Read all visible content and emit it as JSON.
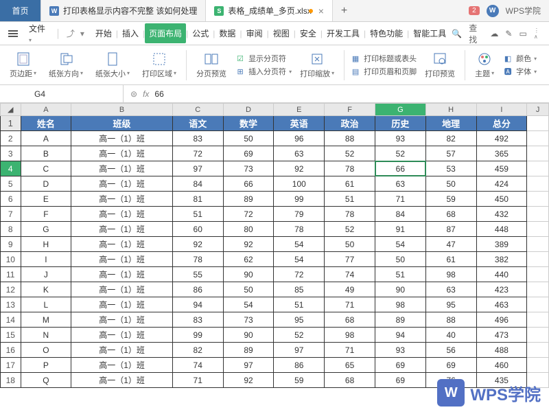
{
  "tabs": {
    "home": "首页",
    "doc1": "打印表格显示内容不完整 该如何处理",
    "doc2": "表格_成绩单_多页.xlsx",
    "badge": "2"
  },
  "menu": {
    "file": "文件",
    "tabs": [
      "开始",
      "插入",
      "页面布局",
      "公式",
      "数据",
      "审阅",
      "视图",
      "安全",
      "开发工具",
      "特色功能",
      "智能工具"
    ],
    "search": "查找"
  },
  "ribbon": {
    "margin": "页边距",
    "orient": "纸张方向",
    "size": "纸张大小",
    "area": "打印区域",
    "preview": "分页预览",
    "showbreak": "显示分页符",
    "insertbreak": "插入分页符",
    "scale": "打印缩放",
    "titles": "打印标题或表头",
    "headerfooter": "打印页眉和页脚",
    "printpreview": "打印预览",
    "theme": "主题",
    "color": "颜色",
    "font": "字体"
  },
  "cell": {
    "ref": "G4",
    "value": "66"
  },
  "headers": [
    "姓名",
    "班级",
    "语文",
    "数学",
    "英语",
    "政治",
    "历史",
    "地理",
    "总分"
  ],
  "cols": [
    "A",
    "B",
    "C",
    "D",
    "E",
    "F",
    "G",
    "H",
    "I",
    "J"
  ],
  "rows": [
    {
      "n": "2",
      "d": [
        "A",
        "高一（1）班",
        "83",
        "50",
        "96",
        "88",
        "93",
        "82",
        "492"
      ]
    },
    {
      "n": "3",
      "d": [
        "B",
        "高一（1）班",
        "72",
        "69",
        "63",
        "52",
        "52",
        "57",
        "365"
      ]
    },
    {
      "n": "4",
      "d": [
        "C",
        "高一（1）班",
        "97",
        "73",
        "92",
        "78",
        "66",
        "53",
        "459"
      ]
    },
    {
      "n": "5",
      "d": [
        "D",
        "高一（1）班",
        "84",
        "66",
        "100",
        "61",
        "63",
        "50",
        "424"
      ]
    },
    {
      "n": "6",
      "d": [
        "E",
        "高一（1）班",
        "81",
        "89",
        "99",
        "51",
        "71",
        "59",
        "450"
      ]
    },
    {
      "n": "7",
      "d": [
        "F",
        "高一（1）班",
        "51",
        "72",
        "79",
        "78",
        "84",
        "68",
        "432"
      ]
    },
    {
      "n": "8",
      "d": [
        "G",
        "高一（1）班",
        "60",
        "80",
        "78",
        "52",
        "91",
        "87",
        "448"
      ]
    },
    {
      "n": "9",
      "d": [
        "H",
        "高一（1）班",
        "92",
        "92",
        "54",
        "50",
        "54",
        "47",
        "389"
      ]
    },
    {
      "n": "10",
      "d": [
        "I",
        "高一（1）班",
        "78",
        "62",
        "54",
        "77",
        "50",
        "61",
        "382"
      ]
    },
    {
      "n": "11",
      "d": [
        "J",
        "高一（1）班",
        "55",
        "90",
        "72",
        "74",
        "51",
        "98",
        "440"
      ]
    },
    {
      "n": "12",
      "d": [
        "K",
        "高一（1）班",
        "86",
        "50",
        "85",
        "49",
        "90",
        "63",
        "423"
      ]
    },
    {
      "n": "13",
      "d": [
        "L",
        "高一（1）班",
        "94",
        "54",
        "51",
        "71",
        "98",
        "95",
        "463"
      ]
    },
    {
      "n": "14",
      "d": [
        "M",
        "高一（1）班",
        "83",
        "73",
        "95",
        "68",
        "89",
        "88",
        "496"
      ]
    },
    {
      "n": "15",
      "d": [
        "N",
        "高一（1）班",
        "99",
        "90",
        "52",
        "98",
        "94",
        "40",
        "473"
      ]
    },
    {
      "n": "16",
      "d": [
        "O",
        "高一（1）班",
        "82",
        "89",
        "97",
        "71",
        "93",
        "56",
        "488"
      ]
    },
    {
      "n": "17",
      "d": [
        "P",
        "高一（1）班",
        "74",
        "97",
        "86",
        "65",
        "69",
        "69",
        "460"
      ]
    },
    {
      "n": "18",
      "d": [
        "Q",
        "高一（1）班",
        "71",
        "92",
        "59",
        "68",
        "69",
        "76",
        "435"
      ]
    }
  ],
  "watermark": "WPS学院"
}
